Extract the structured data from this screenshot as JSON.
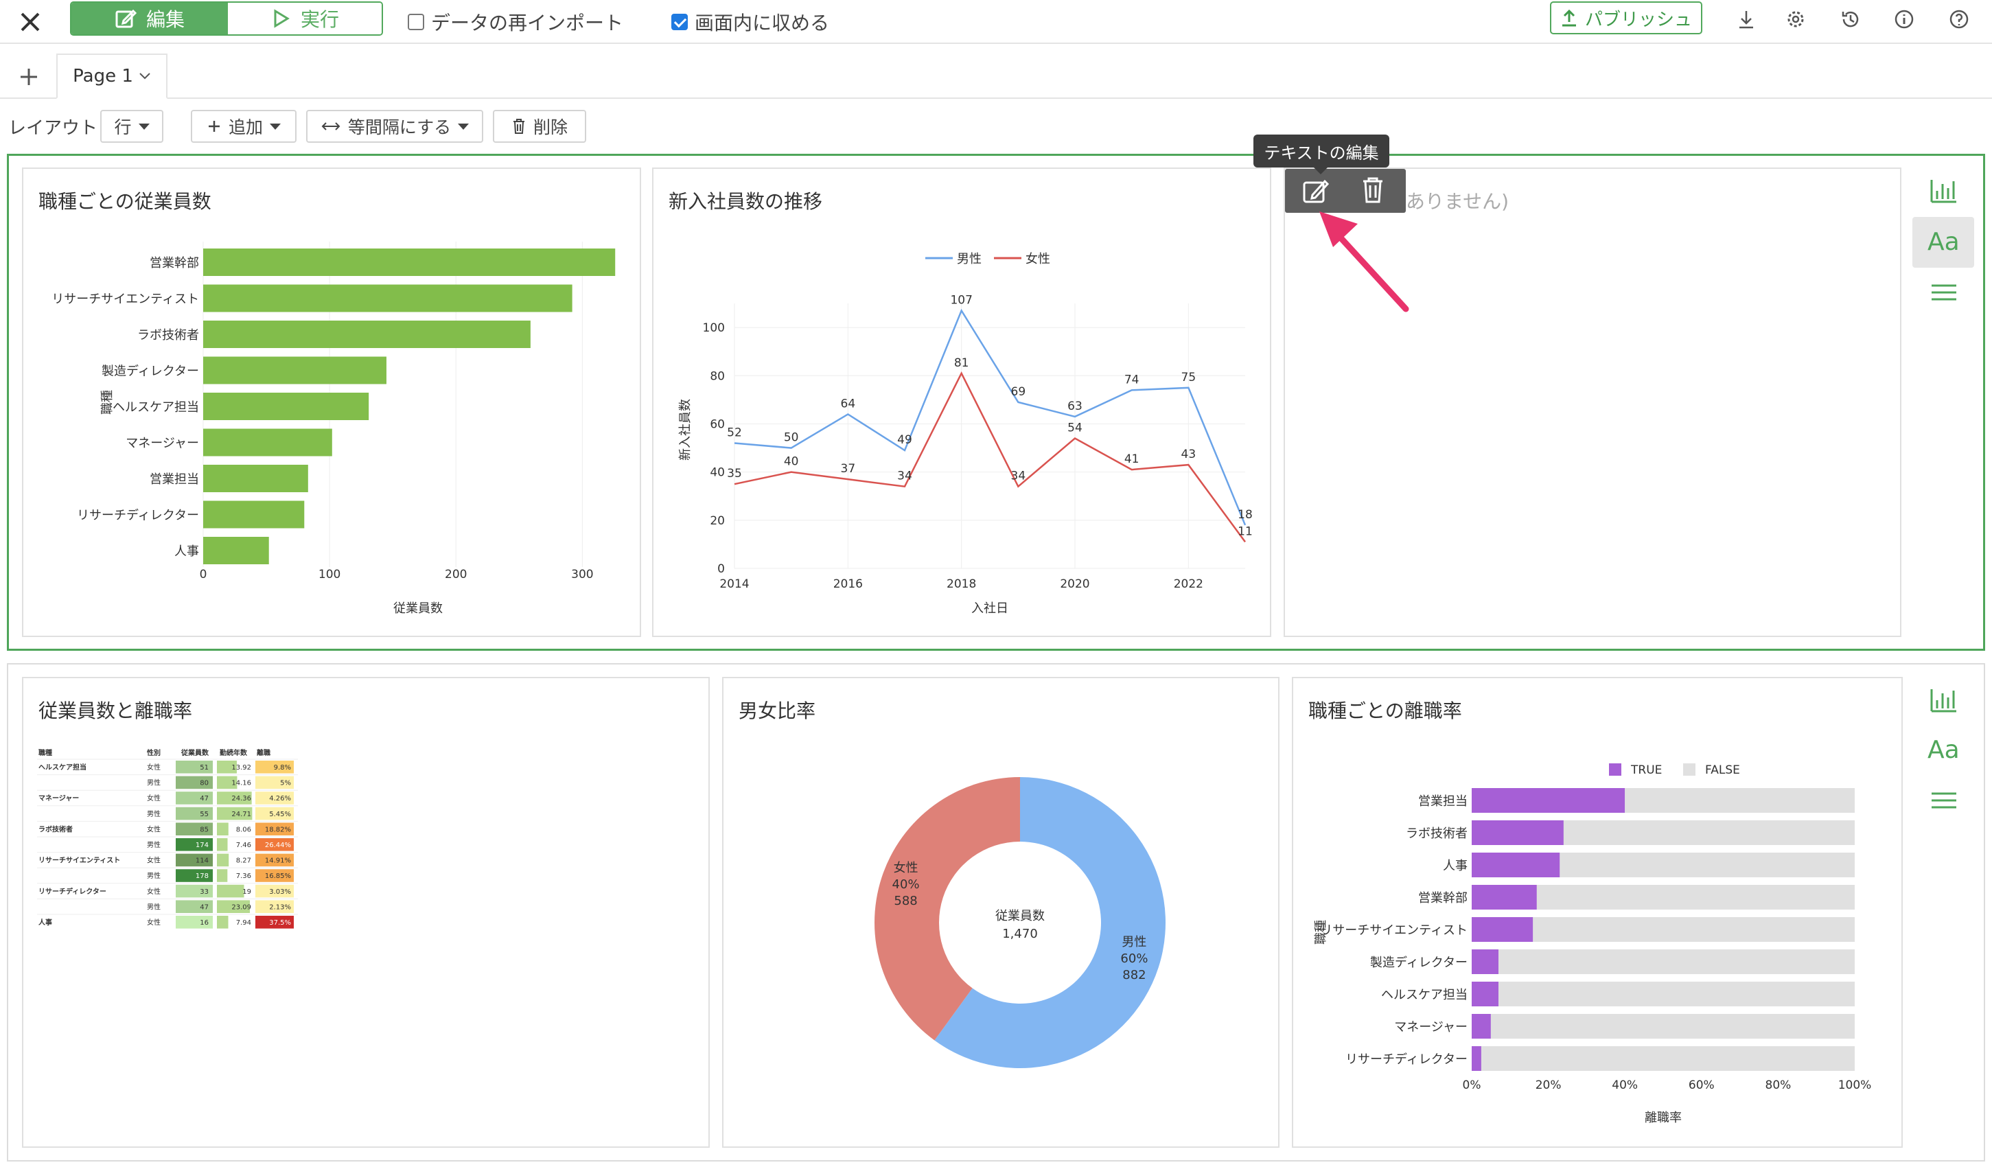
{
  "toolbar": {
    "edit_label": "編集",
    "run_label": "実行",
    "reimport_label": "データの再インポート",
    "reimport_checked": false,
    "fit_label": "画面内に収める",
    "fit_checked": true,
    "publish_label": "パブリッシュ",
    "accent_color": "#5aac62"
  },
  "tabs": {
    "page_label": "Page 1"
  },
  "layout_bar": {
    "label": "レイアウト",
    "row_select": "行",
    "add_label": "追加",
    "equal_spacing_label": "等間隔にする",
    "delete_label": "削除"
  },
  "text_panel": {
    "tooltip": "テキストの編集",
    "placeholder": "ありません)"
  },
  "cards": {
    "c1_title": "職種ごとの従業員数",
    "c2_title": "新入社員数の推移",
    "c4_title": "従業員数と離職率",
    "c5_title": "男女比率",
    "c6_title": "職種ごとの離職率"
  },
  "chart_data": [
    {
      "type": "bar",
      "orientation": "horizontal",
      "title": "職種ごとの従業員数",
      "categories": [
        "営業幹部",
        "リサーチサイエンティスト",
        "ラボ技術者",
        "製造ディレクター",
        "ヘルスケア担当",
        "マネージャー",
        "営業担当",
        "リサーチディレクター",
        "人事"
      ],
      "values": [
        326,
        292,
        259,
        145,
        131,
        102,
        83,
        80,
        52
      ],
      "xlabel": "従業員数",
      "ylabel": "職種",
      "xticks": [
        "0",
        "100",
        "200",
        "300"
      ],
      "xlim": [
        0,
        340
      ],
      "color": "#82bd4b"
    },
    {
      "type": "line",
      "title": "新入社員数の推移",
      "x": [
        2014,
        2015,
        2016,
        2017,
        2018,
        2019,
        2020,
        2021,
        2022,
        2023
      ],
      "xticks": [
        "2014",
        "2016",
        "2018",
        "2020",
        "2022"
      ],
      "yticks": [
        "0",
        "20",
        "40",
        "60",
        "80",
        "100"
      ],
      "xlabel": "入社日",
      "ylabel": "新入社員数",
      "ylim": [
        0,
        110
      ],
      "series": [
        {
          "name": "男性",
          "color": "#6aa3e8",
          "values": [
            52,
            50,
            64,
            49,
            107,
            69,
            63,
            74,
            75,
            18
          ],
          "labels": [
            "52",
            "50",
            "64",
            "49",
            "107",
            "69",
            "63",
            "74",
            "75",
            "18"
          ]
        },
        {
          "name": "女性",
          "color": "#d9534f",
          "values": [
            35,
            40,
            37,
            34,
            81,
            34,
            54,
            41,
            43,
            11
          ],
          "labels": [
            "35",
            "40",
            "37",
            "34",
            "81",
            "34",
            "54",
            "41",
            "43",
            "11"
          ]
        }
      ]
    },
    {
      "type": "table",
      "title": "従業員数と離職率",
      "columns": [
        "職種",
        "性別",
        "従業員数",
        "勤続年数",
        "離職"
      ],
      "rows": [
        [
          "ヘルスケア担当",
          "女性",
          "51",
          "13.92",
          "9.8%"
        ],
        [
          "",
          "男性",
          "80",
          "14.16",
          "5%"
        ],
        [
          "マネージャー",
          "女性",
          "47",
          "24.36",
          "4.26%"
        ],
        [
          "",
          "男性",
          "55",
          "24.71",
          "5.45%"
        ],
        [
          "ラボ技術者",
          "女性",
          "85",
          "8.06",
          "18.82%"
        ],
        [
          "",
          "男性",
          "174",
          "7.46",
          "26.44%"
        ],
        [
          "リサーチサイエンティスト",
          "女性",
          "114",
          "8.27",
          "14.91%"
        ],
        [
          "",
          "男性",
          "178",
          "7.36",
          "16.85%"
        ],
        [
          "リサーチディレクター",
          "女性",
          "33",
          "19",
          "3.03%"
        ],
        [
          "",
          "男性",
          "47",
          "23.09",
          "2.13%"
        ],
        [
          "人事",
          "女性",
          "16",
          "7.94",
          "37.5%"
        ]
      ]
    },
    {
      "type": "pie",
      "title": "男女比率",
      "center_label": "従業員数",
      "center_value": "1,470",
      "slices": [
        {
          "name": "男性",
          "value": 882,
          "percent": "60%",
          "color": "#82b6f2"
        },
        {
          "name": "女性",
          "value": 588,
          "percent": "40%",
          "color": "#de8178"
        }
      ]
    },
    {
      "type": "bar",
      "orientation": "horizontal",
      "stacked": true,
      "title": "職種ごとの離職率",
      "categories": [
        "営業担当",
        "ラボ技術者",
        "人事",
        "営業幹部",
        "リサーチサイエンティスト",
        "製造ディレクター",
        "ヘルスケア担当",
        "マネージャー",
        "リサーチディレクター"
      ],
      "series": [
        {
          "name": "TRUE",
          "color": "#a65fd6",
          "values": [
            0.4,
            0.24,
            0.23,
            0.17,
            0.16,
            0.07,
            0.07,
            0.05,
            0.025
          ]
        },
        {
          "name": "FALSE",
          "color": "#e0e0e0",
          "values": [
            0.6,
            0.76,
            0.77,
            0.83,
            0.84,
            0.93,
            0.93,
            0.95,
            0.975
          ]
        }
      ],
      "xticks": [
        "0%",
        "20%",
        "40%",
        "60%",
        "80%",
        "100%"
      ],
      "xlabel": "離職率",
      "ylabel": "職種"
    }
  ]
}
